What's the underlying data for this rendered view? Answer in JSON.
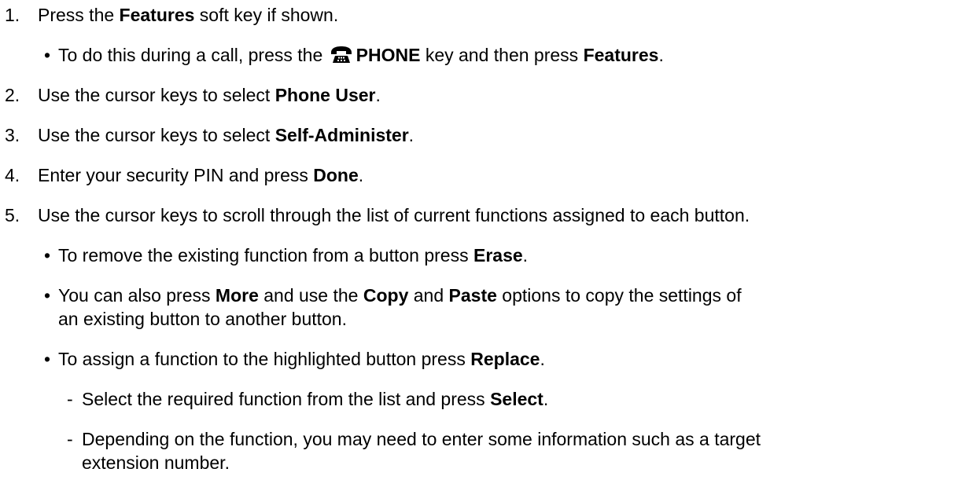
{
  "steps": {
    "s1": {
      "num": "1.",
      "t1": "Press the ",
      "b1": "Features",
      "t2": " soft key if shown.",
      "sub1": {
        "bullet": "•",
        "t1": "To do this during a call, press the ",
        "icon": "phone-icon",
        "b1": "PHONE",
        "t2": " key and then press ",
        "b2": "Features",
        "t3": "."
      }
    },
    "s2": {
      "num": "2.",
      "t1": "Use the cursor keys to select ",
      "b1": "Phone User",
      "t2": "."
    },
    "s3": {
      "num": "3.",
      "t1": "Use the cursor keys to select ",
      "b1": "Self-Administer",
      "t2": "."
    },
    "s4": {
      "num": "4.",
      "t1": "Enter your security PIN and press ",
      "b1": "Done",
      "t2": "."
    },
    "s5": {
      "num": "5.",
      "t1": "Use the cursor keys to scroll through the list of current functions assigned to each button.",
      "sub1": {
        "bullet": "•",
        "t1": "To remove the existing function from a button press ",
        "b1": "Erase",
        "t2": "."
      },
      "sub2": {
        "bullet": "•",
        "t1": "You can also press ",
        "b1": "More",
        "t2": " and use the ",
        "b2": "Copy",
        "t3": " and ",
        "b3": "Paste",
        "t4": " options to copy the settings of",
        "line2": "an existing button to another button."
      },
      "sub3": {
        "bullet": "•",
        "t1": "To assign a function to the highlighted button press ",
        "b1": "Replace",
        "t2": ".",
        "sub1": {
          "dash": "-",
          "t1": "Select the required function from the list and press ",
          "b1": "Select",
          "t2": "."
        },
        "sub2": {
          "dash": "-",
          "t1": "Depending on the function, you may need to enter some information such as a target",
          "line2": "extension number."
        }
      }
    }
  }
}
